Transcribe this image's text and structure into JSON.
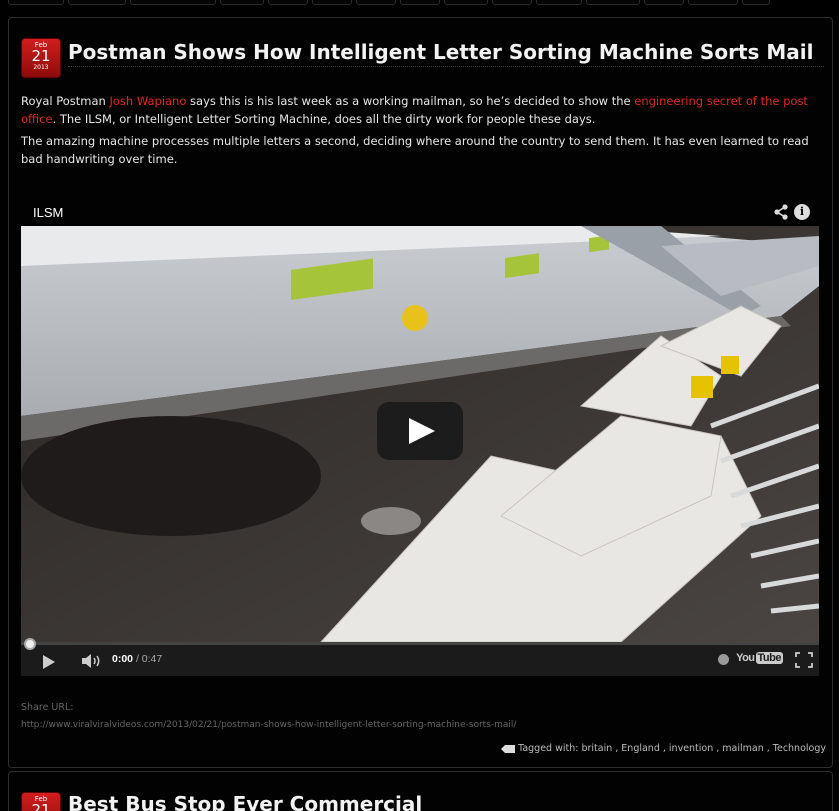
{
  "post": {
    "date": {
      "month": "Feb",
      "day": "21",
      "year": "2013"
    },
    "title": "Postman Shows How Intelligent Letter Sorting Machine Sorts Mail",
    "p1": {
      "t1": "Royal Postman ",
      "link1": "Josh Wapiano",
      "t2": " says this is his last week as a working mailman, so he’s decided to show the ",
      "link2": "engineering secret of the post office",
      "t3": ". The ILSM, or Intelligent Letter Sorting Machine, does all the dirty work for people these days."
    },
    "p2": "The amazing machine processes multiple letters a second, deciding where around the country to send them. It has even learned to read bad handwriting over time.",
    "video": {
      "title": "ILSM",
      "current_time": "0:00",
      "duration": "/ 0:47",
      "progress": 0,
      "logo_you": "You",
      "logo_tube": "Tube"
    },
    "share": {
      "label": "Share URL:",
      "url": "http://www.viralviralvideos.com/2013/02/21/postman-shows-how-intelligent-letter-sorting-machine-sorts-mail/"
    },
    "tags": {
      "label": "Tagged with:",
      "items": [
        "britain",
        "England",
        "invention",
        "mailman",
        "Technology"
      ]
    }
  },
  "next_post": {
    "date": {
      "month": "Feb",
      "day": "21"
    },
    "title": "Best Bus Stop Ever Commercial"
  },
  "colors": {
    "accent": "#e0281f",
    "background": "#000000"
  },
  "icons": [
    "share-icon",
    "info-icon",
    "play-icon",
    "volume-icon",
    "watch-later-icon",
    "fullscreen-icon",
    "tag-icon"
  ]
}
